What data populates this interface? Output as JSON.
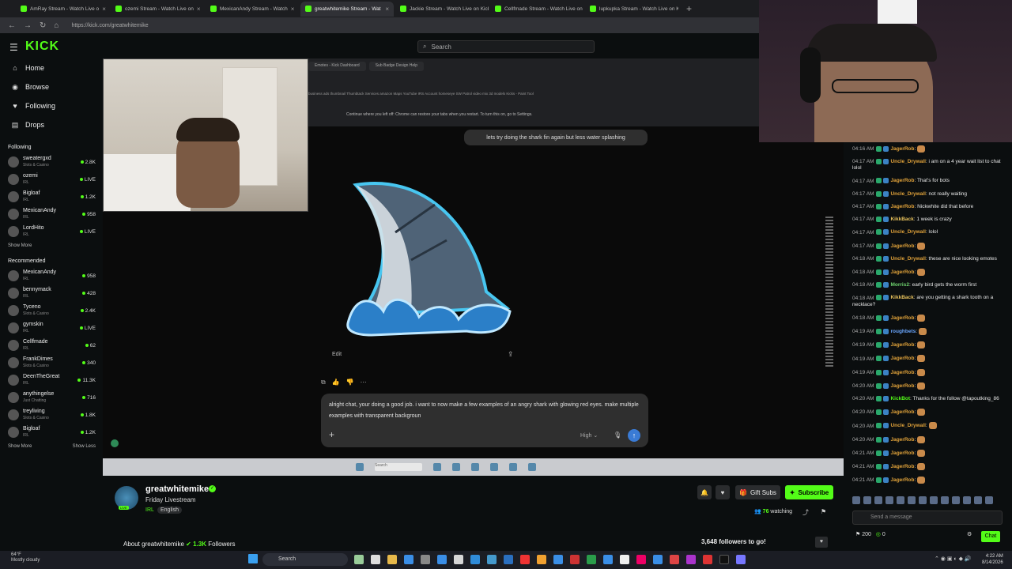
{
  "browser": {
    "tabs": [
      {
        "label": "AmRay Stream - Watch Live o",
        "active": false
      },
      {
        "label": "ozemi Stream - Watch Live on",
        "active": false
      },
      {
        "label": "MexicanAndy Stream - Watch",
        "active": false
      },
      {
        "label": "greatwhitemike Stream - Wat",
        "active": true
      },
      {
        "label": "Jackie Stream - Watch Live on Kick",
        "active": false
      },
      {
        "label": "Cellfmade Stream - Watch Live on",
        "active": false
      },
      {
        "label": "lupkupka Stream - Watch Live on Ki",
        "active": false
      }
    ],
    "url": "https://kick.com/greatwhitemike"
  },
  "kick": {
    "logo": "KICK",
    "search_placeholder": "Search"
  },
  "sidebar": {
    "nav": [
      {
        "label": "Home",
        "icon": "home-icon"
      },
      {
        "label": "Browse",
        "icon": "browse-icon"
      },
      {
        "label": "Following",
        "icon": "heart-icon"
      },
      {
        "label": "Drops",
        "icon": "drops-icon"
      }
    ],
    "following_title": "Following",
    "following": [
      {
        "name": "sweatergxd",
        "category": "Slots & Casino",
        "viewers": "2.8K"
      },
      {
        "name": "ozemi",
        "category": "IRL",
        "viewers": "LIVE"
      },
      {
        "name": "Bigloaf",
        "category": "IRL",
        "viewers": "1.2K"
      },
      {
        "name": "MexicanAndy",
        "category": "IRL",
        "viewers": "958"
      },
      {
        "name": "LordHito",
        "category": "IRL",
        "viewers": "LIVE"
      }
    ],
    "show_more": "Show More",
    "recommended_title": "Recommended",
    "recommended": [
      {
        "name": "MexicanAndy",
        "category": "IRL",
        "viewers": "958"
      },
      {
        "name": "bennymack",
        "category": "IRL",
        "viewers": "428"
      },
      {
        "name": "Tyceno",
        "category": "Slots & Casino",
        "viewers": "2.4K"
      },
      {
        "name": "gymskin",
        "category": "IRL",
        "viewers": "LIVE"
      },
      {
        "name": "Cellfmade",
        "category": "IRL",
        "viewers": "62"
      },
      {
        "name": "FrankDimes",
        "category": "Slots & Casino",
        "viewers": "340"
      },
      {
        "name": "DeenTheGreat",
        "category": "IRL",
        "viewers": "11.3K"
      },
      {
        "name": "anythingelse",
        "category": "Just Chatting",
        "viewers": "716"
      },
      {
        "name": "treyliving",
        "category": "Slots & Casino",
        "viewers": "1.8K"
      },
      {
        "name": "Bigloaf",
        "category": "IRL",
        "viewers": "1.2K"
      }
    ],
    "show_more_2": "Show More",
    "show_less": "Show Less"
  },
  "stream": {
    "inner_tabs": [
      "Emotes - Kick Dashboard",
      "Sub Badge Design Help"
    ],
    "bookmarks": "business   ads   thumbnail   Thumbtack Services   amazon   Maps   YouTube   IRS Account   homeseye   SW Patrol   video mix   3d models   Kicks - Paint Tool",
    "restore_notice": "Continue where you left off: Chrome can restore your tabs when you restart. To turn this on, go to Settings.",
    "prompt_bubble": "lets try doing the shark fin again but less water splashing",
    "edit_label": "Edit",
    "composer_text": "alright chat, your doing a good job. i want to now make a few examples of an angry shark with glowing red eyes. make multiple examples with transparent backgroun",
    "quality": "High",
    "inner_search": "Search"
  },
  "channel": {
    "name": "greatwhitemike",
    "title": "Friday Livestream",
    "tag_category": "IRL",
    "tag_language": "English",
    "live_badge": "LIVE",
    "gift_subs": "Gift Subs",
    "subscribe": "Subscribe",
    "watching_count": "76",
    "watching_label": "watching",
    "about_prefix": "About greatwhitemike",
    "followers_count": "1.3K",
    "followers_label": "Followers",
    "followers_goal": "3,648 followers to go!"
  },
  "chat": {
    "messages": [
      {
        "time": "04:16 AM",
        "user": "JagerRob",
        "color": "#e0a23a",
        "text": "",
        "emote": true
      },
      {
        "time": "04:17 AM",
        "user": "Uncle_Drywall",
        "color": "#e0a23a",
        "text": "i am on a 4 year wait list to chat lolol"
      },
      {
        "time": "04:17 AM",
        "user": "JagerRob",
        "color": "#e0a23a",
        "text": "That's for bots"
      },
      {
        "time": "04:17 AM",
        "user": "Uncle_Drywall",
        "color": "#e0a23a",
        "text": "not really waiting"
      },
      {
        "time": "04:17 AM",
        "user": "JagerRob",
        "color": "#e0a23a",
        "text": "Nickwhite did that before"
      },
      {
        "time": "04:17 AM",
        "user": "KikkBack",
        "color": "#e8c25c",
        "text": "1 week is crazy"
      },
      {
        "time": "04:17 AM",
        "user": "Uncle_Drywall",
        "color": "#e0a23a",
        "text": "lolol"
      },
      {
        "time": "04:17 AM",
        "user": "JagerRob",
        "color": "#e0a23a",
        "text": "",
        "emote": true
      },
      {
        "time": "04:18 AM",
        "user": "Uncle_Drywall",
        "color": "#e0a23a",
        "text": "these are nice looking emotes"
      },
      {
        "time": "04:18 AM",
        "user": "JagerRob",
        "color": "#e0a23a",
        "text": "",
        "emote": true
      },
      {
        "time": "04:18 AM",
        "user": "Morris2",
        "color": "#6fd36f",
        "text": "early bird gets the worm first"
      },
      {
        "time": "04:18 AM",
        "user": "KikkBack",
        "color": "#e8c25c",
        "text": "are you getting a shark tooth on a necklace?"
      },
      {
        "time": "04:18 AM",
        "user": "JagerRob",
        "color": "#e0a23a",
        "text": "",
        "emote": true
      },
      {
        "time": "04:19 AM",
        "user": "roughbets",
        "color": "#6aa7ff",
        "text": "",
        "emote": true
      },
      {
        "time": "04:19 AM",
        "user": "JagerRob",
        "color": "#e0a23a",
        "text": "",
        "emote": true
      },
      {
        "time": "04:19 AM",
        "user": "JagerRob",
        "color": "#e0a23a",
        "text": "",
        "emote": true
      },
      {
        "time": "04:19 AM",
        "user": "JagerRob",
        "color": "#e0a23a",
        "text": "",
        "emote": true
      },
      {
        "time": "04:20 AM",
        "user": "JagerRob",
        "color": "#e0a23a",
        "text": "",
        "emote": true
      },
      {
        "time": "04:20 AM",
        "user": "KickBot",
        "color": "#53fc18",
        "text": "Thanks for the follow @tapoutking_86"
      },
      {
        "time": "04:20 AM",
        "user": "JagerRob",
        "color": "#e0a23a",
        "text": "",
        "emote": true
      },
      {
        "time": "04:20 AM",
        "user": "Uncle_Drywall",
        "color": "#e0a23a",
        "text": "",
        "emote": true
      },
      {
        "time": "04:20 AM",
        "user": "JagerRob",
        "color": "#e0a23a",
        "text": "",
        "emote": true
      },
      {
        "time": "04:21 AM",
        "user": "JagerRob",
        "color": "#e0a23a",
        "text": "",
        "emote": true
      },
      {
        "time": "04:21 AM",
        "user": "JagerRob",
        "color": "#e0a23a",
        "text": "",
        "emote": true
      },
      {
        "time": "04:21 AM",
        "user": "JagerRob",
        "color": "#e0a23a",
        "text": "",
        "emote": true
      }
    ],
    "input_placeholder": "Send a message",
    "points": "200",
    "zero": "0",
    "chat_button": "Chat"
  },
  "taskbar": {
    "temp": "64°F",
    "weather": "Mostly cloudy",
    "search": "Search",
    "time": "4:22 AM",
    "date": "8/14/2026"
  }
}
